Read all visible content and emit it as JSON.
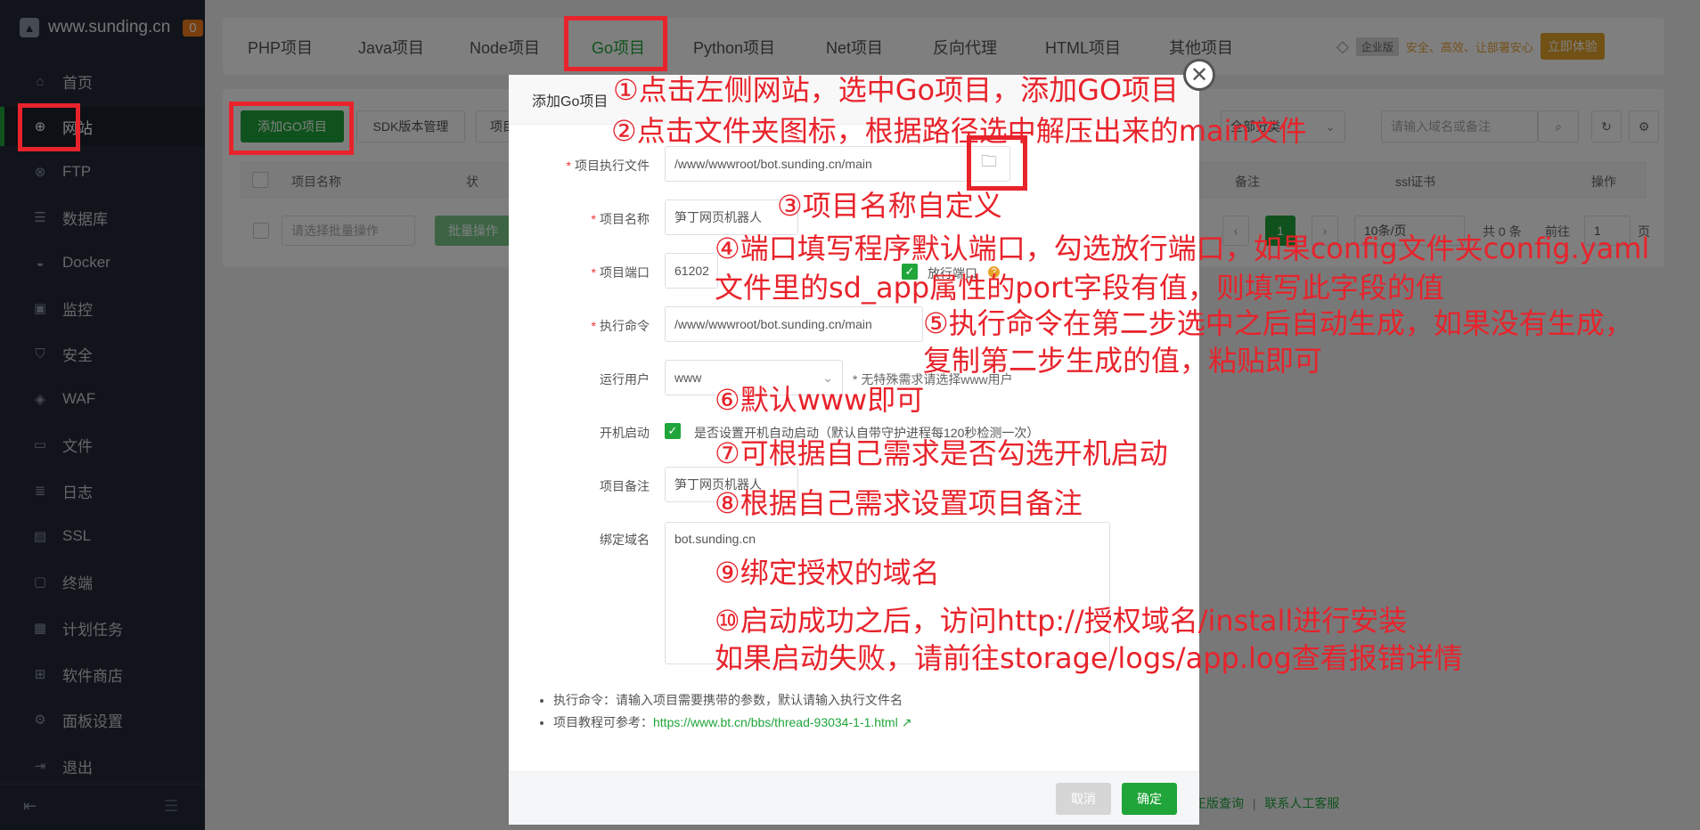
{
  "sidebar": {
    "site": "www.sunding.cn",
    "badge": "0",
    "items": [
      {
        "label": "首页",
        "icon": "home-icon"
      },
      {
        "label": "网站",
        "icon": "globe-icon",
        "active": true
      },
      {
        "label": "FTP",
        "icon": "ftp-icon"
      },
      {
        "label": "数据库",
        "icon": "database-icon"
      },
      {
        "label": "Docker",
        "icon": "docker-icon"
      },
      {
        "label": "监控",
        "icon": "monitor-icon"
      },
      {
        "label": "安全",
        "icon": "shield-icon"
      },
      {
        "label": "WAF",
        "icon": "waf-icon"
      },
      {
        "label": "文件",
        "icon": "folder-icon"
      },
      {
        "label": "日志",
        "icon": "log-icon"
      },
      {
        "label": "SSL",
        "icon": "ssl-icon"
      },
      {
        "label": "终端",
        "icon": "terminal-icon"
      },
      {
        "label": "计划任务",
        "icon": "calendar-icon"
      },
      {
        "label": "软件商店",
        "icon": "store-icon"
      },
      {
        "label": "面板设置",
        "icon": "gear-icon"
      },
      {
        "label": "退出",
        "icon": "logout-icon"
      }
    ]
  },
  "tabs": [
    "PHP项目",
    "Java项目",
    "Node项目",
    "Go项目",
    "Python项目",
    "Net项目",
    "反向代理",
    "HTML项目",
    "其他项目"
  ],
  "active_tab": "Go项目",
  "enterprise": {
    "tag": "企业版",
    "slogan": "安全、高效、让部署安心",
    "try": "立即体验"
  },
  "toolbar": {
    "add": "添加GO项目",
    "sdk": "SDK版本管理",
    "more": "项目",
    "category": "全部分类",
    "search_placeholder": "请输入域名或备注"
  },
  "table": {
    "headers": [
      "项目名称",
      "状",
      "备注",
      "ssl证书",
      "操作"
    ],
    "batch_placeholder": "请选择批量操作",
    "batch_button": "批量操作",
    "page": "1",
    "page_size": "10条/页",
    "total": "共 0 条",
    "goto": "前往",
    "goto_page": "1",
    "page_unit": "页"
  },
  "footer": {
    "link1": "正版查询",
    "sep": "|",
    "link2": "联系人工客服"
  },
  "modal": {
    "title": "添加Go项目",
    "fields": {
      "exec_label": "项目执行文件",
      "exec_value": "/www/wwwroot/bot.sunding.cn/main",
      "name_label": "项目名称",
      "name_value": "笋丁网页机器人",
      "port_label": "项目端口",
      "port_value": "61202",
      "port_open": "放行端口",
      "cmd_label": "执行命令",
      "cmd_value": "/www/wwwroot/bot.sunding.cn/main",
      "user_label": "运行用户",
      "user_value": "www",
      "user_hint": "* 无特殊需求请选择www用户",
      "boot_label": "开机启动",
      "boot_text": "是否设置开机自动启动（默认自带守护进程每120秒检测一次）",
      "remark_label": "项目备注",
      "remark_value": "笋丁网页机器人",
      "domain_label": "绑定域名",
      "domain_value": "bot.sunding.cn"
    },
    "tips": [
      "执行命令：请输入项目需要携带的参数，默认请输入执行文件名",
      "项目教程可参考："
    ],
    "tip_link": "https://www.bt.cn/bbs/thread-93034-1-1.html",
    "cancel": "取消",
    "confirm": "确定"
  },
  "annotations": {
    "a1": "①点击左侧网站，选中Go项目，添加GO项目",
    "a2": "②点击文件夹图标，根据路径选中解压出来的main文件",
    "a3": "③项目名称自定义",
    "a4a": "④端口填写程序默认端口，勾选放行端口，如果config文件夹config.yaml",
    "a4b": "文件里的sd_app属性的port字段有值，则填写此字段的值",
    "a5a": "⑤执行命令在第二步选中之后自动生成，如果没有生成，",
    "a5b": "复制第二步生成的值，粘贴即可",
    "a6": "⑥默认www即可",
    "a7": "⑦可根据自己需求是否勾选开机启动",
    "a8": "⑧根据自己需求设置项目备注",
    "a9": "⑨绑定授权的域名",
    "a10a": "⑩启动成功之后，访问http://授权域名/install进行安装",
    "a10b": "如果启动失败，请前往storage/logs/app.log查看报错详情"
  },
  "colors": {
    "accent": "#20a53a",
    "annotation": "#e8232b",
    "sidebar": "#222a36"
  }
}
